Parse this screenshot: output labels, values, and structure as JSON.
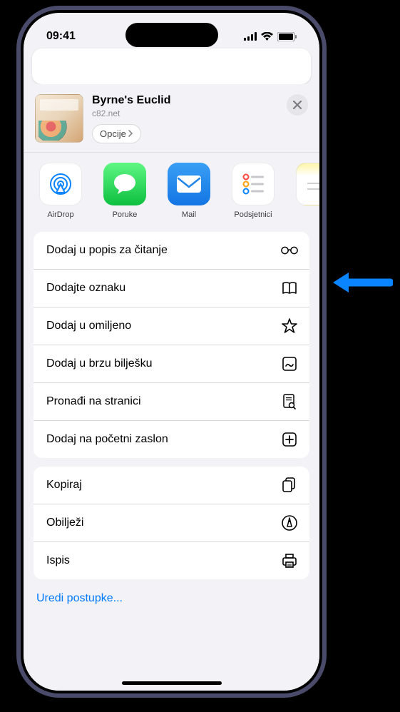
{
  "statusBar": {
    "time": "09:41"
  },
  "header": {
    "title": "Byrne's Euclid",
    "subtitle": "c82.net",
    "optionsLabel": "Opcije"
  },
  "shareApps": [
    {
      "label": "AirDrop",
      "icon": "airdrop-icon"
    },
    {
      "label": "Poruke",
      "icon": "messages-icon"
    },
    {
      "label": "Mail",
      "icon": "mail-icon"
    },
    {
      "label": "Podsjetnici",
      "icon": "reminders-icon"
    },
    {
      "label": "",
      "icon": "notes-icon"
    }
  ],
  "actionsGroup1": [
    {
      "label": "Dodaj u popis za čitanje",
      "icon": "glasses-icon"
    },
    {
      "label": "Dodajte oznaku",
      "icon": "book-icon"
    },
    {
      "label": "Dodaj u omiljeno",
      "icon": "star-icon"
    },
    {
      "label": "Dodaj u brzu bilješku",
      "icon": "quicknote-icon"
    },
    {
      "label": "Pronađi na stranici",
      "icon": "find-icon"
    },
    {
      "label": "Dodaj na početni zaslon",
      "icon": "addhome-icon"
    }
  ],
  "actionsGroup2": [
    {
      "label": "Kopiraj",
      "icon": "copy-icon"
    },
    {
      "label": "Obilježi",
      "icon": "markup-icon"
    },
    {
      "label": "Ispis",
      "icon": "print-icon"
    }
  ],
  "editActions": "Uredi postupke..."
}
